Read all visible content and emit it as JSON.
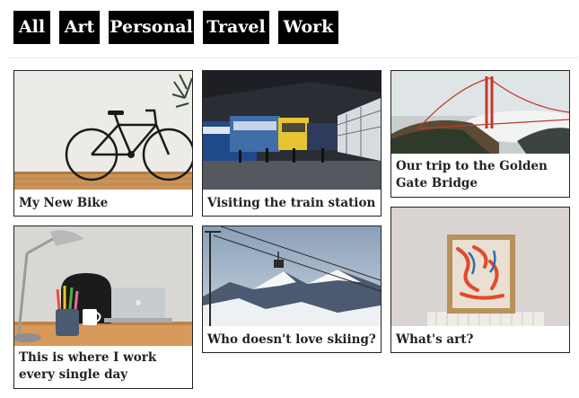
{
  "filters": [
    {
      "label": "All"
    },
    {
      "label": "Art"
    },
    {
      "label": "Personal"
    },
    {
      "label": "Travel"
    },
    {
      "label": "Work"
    }
  ],
  "posts": [
    {
      "title": "My New Bike",
      "image": "bicycle-photo"
    },
    {
      "title": "Visiting the train station",
      "image": "train-station-photo"
    },
    {
      "title": "Our trip to the Golden Gate Bridge",
      "image": "golden-gate-bridge-photo"
    },
    {
      "title": "This is where I work every single day",
      "image": "desk-workspace-photo"
    },
    {
      "title": "Who doesn't love skiing?",
      "image": "ski-lift-mountains-photo"
    },
    {
      "title": "What's art?",
      "image": "framed-painting-photo"
    }
  ]
}
